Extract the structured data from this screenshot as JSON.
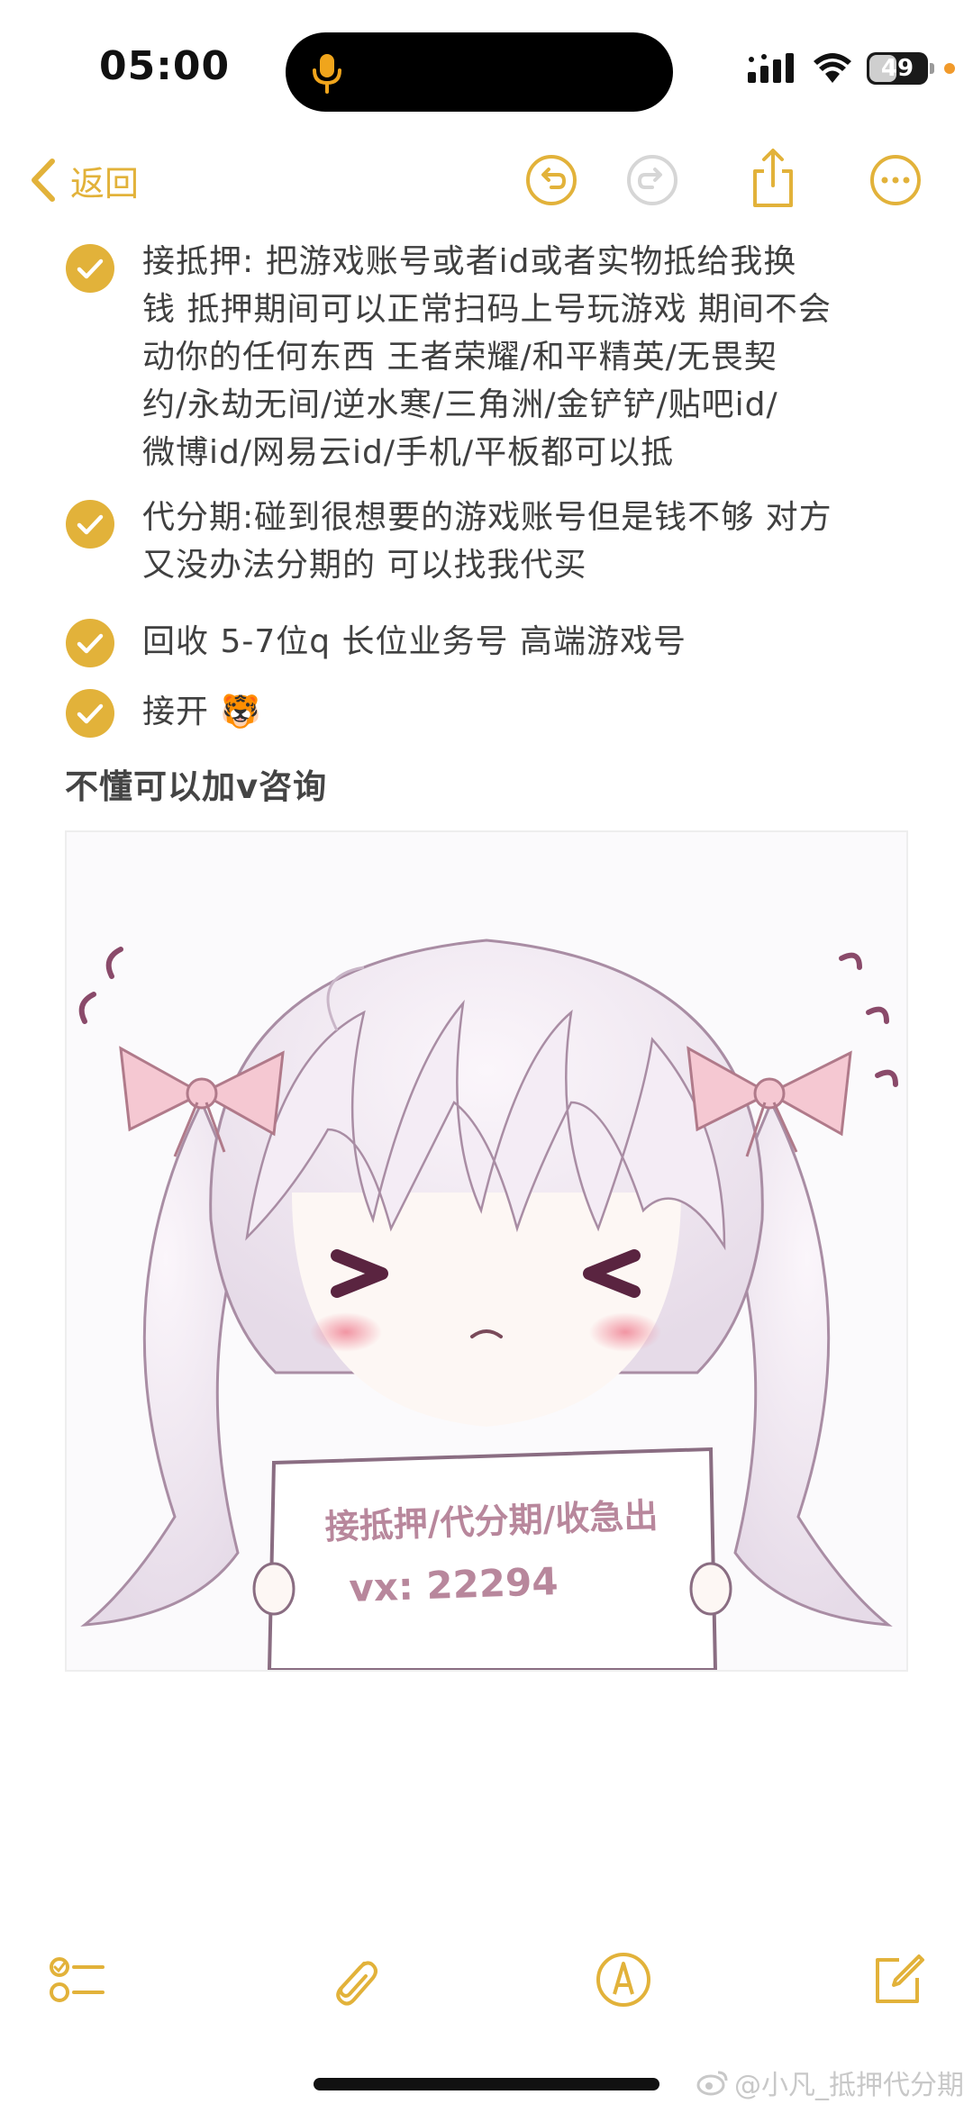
{
  "status_bar": {
    "time": "05:00",
    "battery": "49",
    "battery_level": 0.49,
    "icons": [
      "microphone-icon",
      "signal-icon",
      "wifi-icon",
      "battery-icon"
    ]
  },
  "toolbar": {
    "back_label": "返回",
    "icons": [
      "undo-icon",
      "redo-icon",
      "share-icon",
      "more-icon"
    ],
    "accent_color": "#E2B23A"
  },
  "checklist": [
    {
      "checked": true,
      "lines": [
        "接抵押: 把游戏账号或者id或者实物抵给我换",
        "钱 抵押期间可以正常扫码上号玩游戏 期间不会",
        "动你的任何东西  王者荣耀/和平精英/无畏契",
        "约/永劫无间/逆水寒/三角洲/金铲铲/贴吧id/",
        "微博id/网易云id/手机/平板都可以抵"
      ]
    },
    {
      "checked": true,
      "lines": [
        "代分期:碰到很想要的游戏账号但是钱不够 对方",
        "又没办法分期的 可以找我代买"
      ]
    },
    {
      "checked": true,
      "lines": [
        "回收 5-7位q 长位业务号 高端游戏号"
      ]
    },
    {
      "checked": true,
      "lines": [
        "接开 🐯"
      ]
    }
  ],
  "subheading": "不懂可以加v咨询",
  "image": {
    "sign_line1": "接抵押/代分期/收急出",
    "sign_line2": "vx:  22294"
  },
  "bottom_toolbar": {
    "icons": [
      "checklist-icon",
      "attachment-icon",
      "markup-icon",
      "compose-icon"
    ]
  },
  "watermark": "@小凡_抵押代分期"
}
